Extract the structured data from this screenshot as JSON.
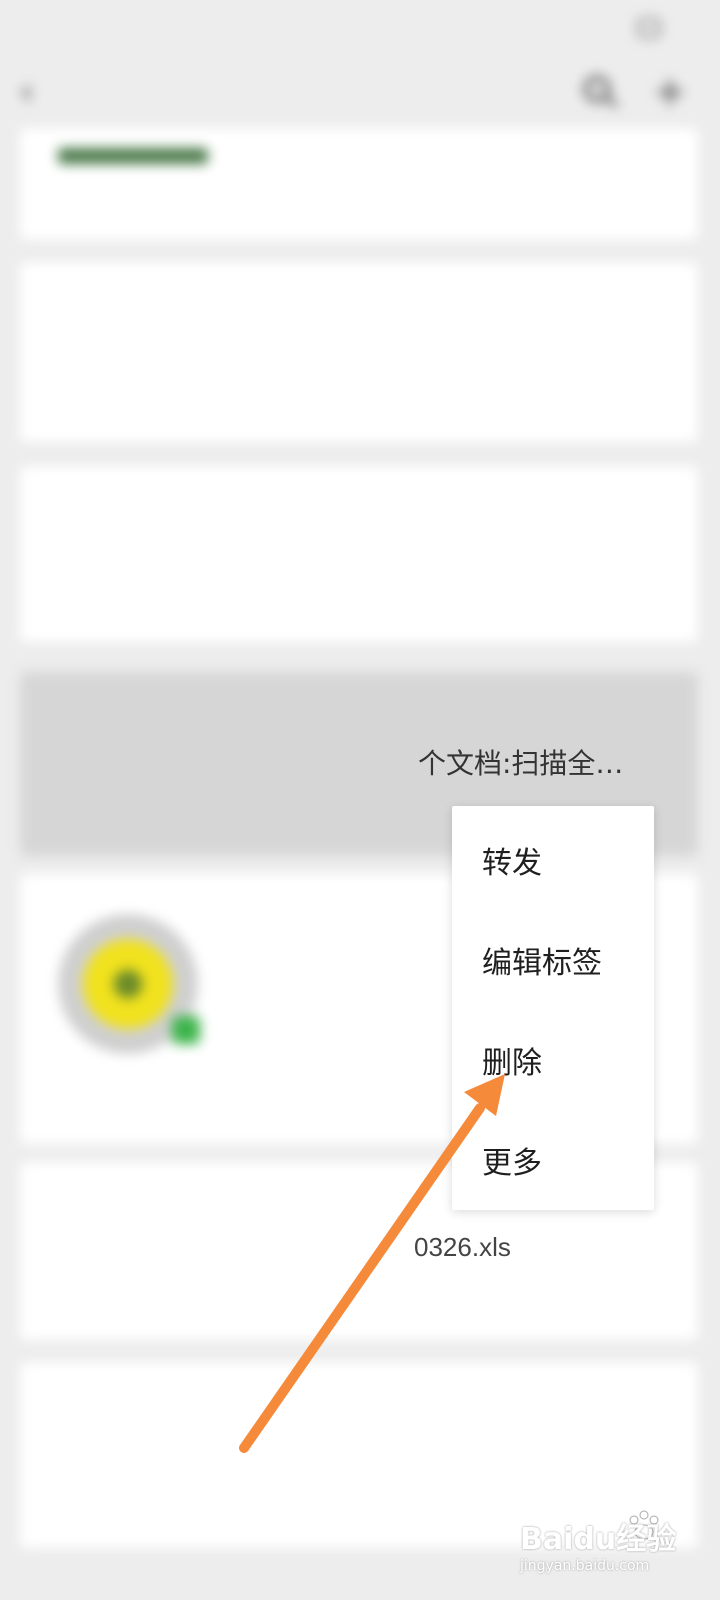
{
  "status_bar": {
    "left_text": "",
    "right_text": ""
  },
  "nav": {
    "title": "",
    "back_glyph": "‹",
    "add_glyph": "+"
  },
  "cards": [
    {
      "meta": "",
      "title": "",
      "foot": ""
    },
    {
      "meta": "",
      "title": "",
      "foot": ""
    },
    {
      "meta": "",
      "title": "",
      "foot": ""
    },
    {
      "meta": "",
      "title": "",
      "foot": ""
    },
    {
      "meta": "",
      "title": "",
      "foot": ""
    },
    {
      "meta": "",
      "title": "",
      "foot": ""
    },
    {
      "meta": "",
      "title": "",
      "foot": ""
    }
  ],
  "visible_fragments": {
    "selected_card_title_suffix": "个文档:扫描全…",
    "file_card_title_suffix": "0326.xls"
  },
  "context_menu": {
    "items": [
      {
        "label": "转发"
      },
      {
        "label": "编辑标签"
      },
      {
        "label": "删除"
      },
      {
        "label": "更多"
      }
    ]
  },
  "arrow": {
    "color": "#f58a3a"
  },
  "watermark": {
    "logo": "Baidu经验",
    "url": "jingyan.baidu.com"
  }
}
